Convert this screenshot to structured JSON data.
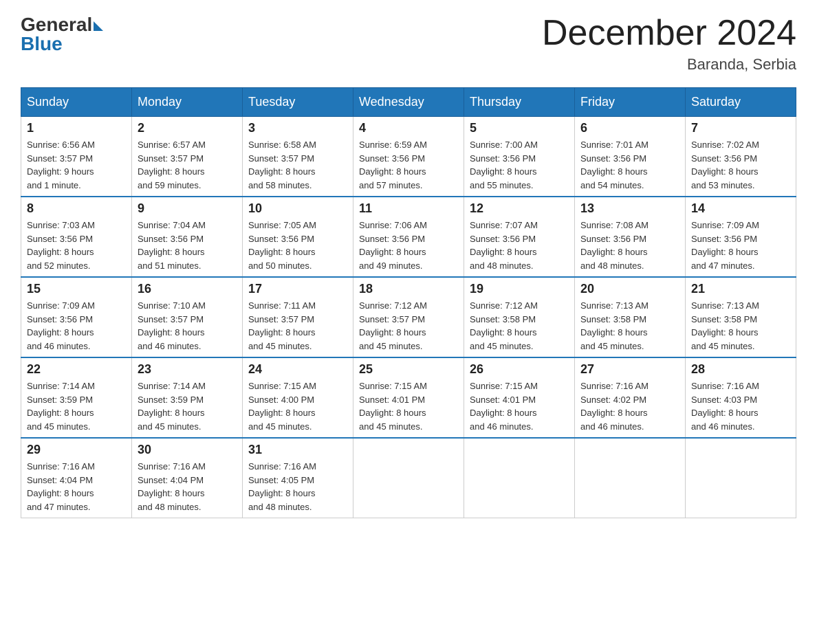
{
  "header": {
    "logo": {
      "text1": "General",
      "text2": "Blue"
    },
    "title": "December 2024",
    "location": "Baranda, Serbia"
  },
  "weekdays": [
    "Sunday",
    "Monday",
    "Tuesday",
    "Wednesday",
    "Thursday",
    "Friday",
    "Saturday"
  ],
  "weeks": [
    [
      {
        "day": "1",
        "sunrise": "6:56 AM",
        "sunset": "3:57 PM",
        "daylight": "9 hours and 1 minute."
      },
      {
        "day": "2",
        "sunrise": "6:57 AM",
        "sunset": "3:57 PM",
        "daylight": "8 hours and 59 minutes."
      },
      {
        "day": "3",
        "sunrise": "6:58 AM",
        "sunset": "3:57 PM",
        "daylight": "8 hours and 58 minutes."
      },
      {
        "day": "4",
        "sunrise": "6:59 AM",
        "sunset": "3:56 PM",
        "daylight": "8 hours and 57 minutes."
      },
      {
        "day": "5",
        "sunrise": "7:00 AM",
        "sunset": "3:56 PM",
        "daylight": "8 hours and 55 minutes."
      },
      {
        "day": "6",
        "sunrise": "7:01 AM",
        "sunset": "3:56 PM",
        "daylight": "8 hours and 54 minutes."
      },
      {
        "day": "7",
        "sunrise": "7:02 AM",
        "sunset": "3:56 PM",
        "daylight": "8 hours and 53 minutes."
      }
    ],
    [
      {
        "day": "8",
        "sunrise": "7:03 AM",
        "sunset": "3:56 PM",
        "daylight": "8 hours and 52 minutes."
      },
      {
        "day": "9",
        "sunrise": "7:04 AM",
        "sunset": "3:56 PM",
        "daylight": "8 hours and 51 minutes."
      },
      {
        "day": "10",
        "sunrise": "7:05 AM",
        "sunset": "3:56 PM",
        "daylight": "8 hours and 50 minutes."
      },
      {
        "day": "11",
        "sunrise": "7:06 AM",
        "sunset": "3:56 PM",
        "daylight": "8 hours and 49 minutes."
      },
      {
        "day": "12",
        "sunrise": "7:07 AM",
        "sunset": "3:56 PM",
        "daylight": "8 hours and 48 minutes."
      },
      {
        "day": "13",
        "sunrise": "7:08 AM",
        "sunset": "3:56 PM",
        "daylight": "8 hours and 48 minutes."
      },
      {
        "day": "14",
        "sunrise": "7:09 AM",
        "sunset": "3:56 PM",
        "daylight": "8 hours and 47 minutes."
      }
    ],
    [
      {
        "day": "15",
        "sunrise": "7:09 AM",
        "sunset": "3:56 PM",
        "daylight": "8 hours and 46 minutes."
      },
      {
        "day": "16",
        "sunrise": "7:10 AM",
        "sunset": "3:57 PM",
        "daylight": "8 hours and 46 minutes."
      },
      {
        "day": "17",
        "sunrise": "7:11 AM",
        "sunset": "3:57 PM",
        "daylight": "8 hours and 45 minutes."
      },
      {
        "day": "18",
        "sunrise": "7:12 AM",
        "sunset": "3:57 PM",
        "daylight": "8 hours and 45 minutes."
      },
      {
        "day": "19",
        "sunrise": "7:12 AM",
        "sunset": "3:58 PM",
        "daylight": "8 hours and 45 minutes."
      },
      {
        "day": "20",
        "sunrise": "7:13 AM",
        "sunset": "3:58 PM",
        "daylight": "8 hours and 45 minutes."
      },
      {
        "day": "21",
        "sunrise": "7:13 AM",
        "sunset": "3:58 PM",
        "daylight": "8 hours and 45 minutes."
      }
    ],
    [
      {
        "day": "22",
        "sunrise": "7:14 AM",
        "sunset": "3:59 PM",
        "daylight": "8 hours and 45 minutes."
      },
      {
        "day": "23",
        "sunrise": "7:14 AM",
        "sunset": "3:59 PM",
        "daylight": "8 hours and 45 minutes."
      },
      {
        "day": "24",
        "sunrise": "7:15 AM",
        "sunset": "4:00 PM",
        "daylight": "8 hours and 45 minutes."
      },
      {
        "day": "25",
        "sunrise": "7:15 AM",
        "sunset": "4:01 PM",
        "daylight": "8 hours and 45 minutes."
      },
      {
        "day": "26",
        "sunrise": "7:15 AM",
        "sunset": "4:01 PM",
        "daylight": "8 hours and 46 minutes."
      },
      {
        "day": "27",
        "sunrise": "7:16 AM",
        "sunset": "4:02 PM",
        "daylight": "8 hours and 46 minutes."
      },
      {
        "day": "28",
        "sunrise": "7:16 AM",
        "sunset": "4:03 PM",
        "daylight": "8 hours and 46 minutes."
      }
    ],
    [
      {
        "day": "29",
        "sunrise": "7:16 AM",
        "sunset": "4:04 PM",
        "daylight": "8 hours and 47 minutes."
      },
      {
        "day": "30",
        "sunrise": "7:16 AM",
        "sunset": "4:04 PM",
        "daylight": "8 hours and 48 minutes."
      },
      {
        "day": "31",
        "sunrise": "7:16 AM",
        "sunset": "4:05 PM",
        "daylight": "8 hours and 48 minutes."
      },
      null,
      null,
      null,
      null
    ]
  ],
  "labels": {
    "sunrise": "Sunrise:",
    "sunset": "Sunset:",
    "daylight": "Daylight:"
  }
}
